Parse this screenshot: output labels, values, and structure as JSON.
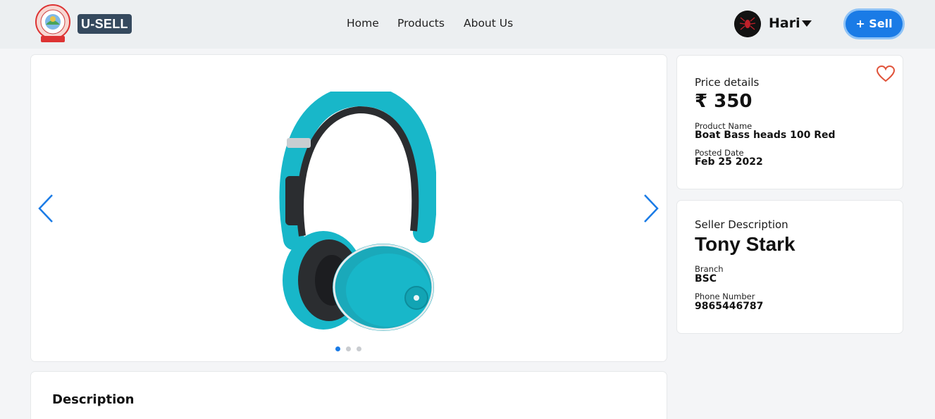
{
  "header": {
    "brand": "U-SELL",
    "nav": [
      "Home",
      "Products",
      "About Us"
    ],
    "user_name": "Hari",
    "sell_button": "+ Sell"
  },
  "gallery": {
    "slide_count": 3,
    "active_slide": 1,
    "image": "teal-headphones"
  },
  "price_card": {
    "heading": "Price details",
    "price": "₹ 350",
    "product_name_label": "Product Name",
    "product_name": "Boat Bass heads 100 Red",
    "posted_date_label": "Posted Date",
    "posted_date": "Feb 25 2022"
  },
  "seller_card": {
    "heading": "Seller Description",
    "seller_name": "Tony Stark",
    "branch_label": "Branch",
    "branch": "BSC",
    "phone_label": "Phone Number",
    "phone": "9865446787"
  },
  "description": {
    "heading": "Description"
  },
  "colors": {
    "accent": "#1a7be6",
    "heart": "#e0533a",
    "headphone": "#18b7c9"
  }
}
